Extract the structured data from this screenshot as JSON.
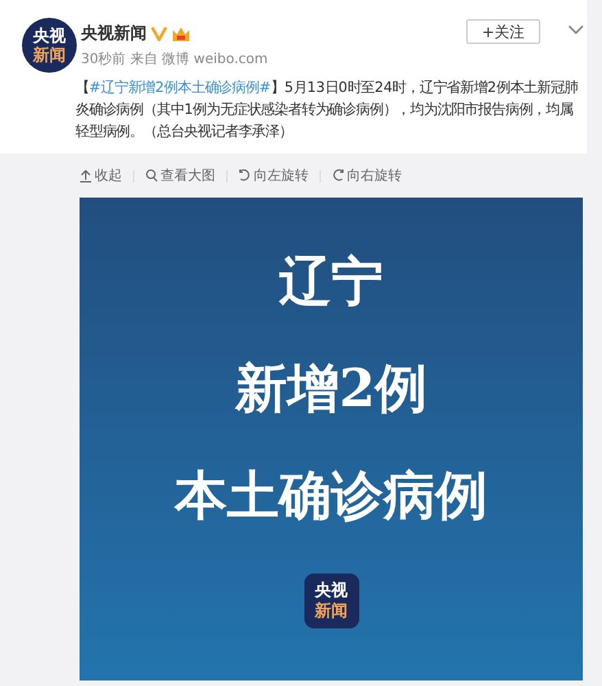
{
  "post": {
    "author": "央视新闻",
    "avatar_text": [
      "央视",
      "新闻"
    ],
    "time": "30秒前",
    "source_prefix": "来自",
    "source": "微博 weibo.com",
    "follow_button": "+关注",
    "hashtag_open": "【",
    "hashtag": "#辽宁新增2例本土确诊病例#",
    "hashtag_close": "】",
    "body": "5月13日0时至24时，辽宁省新增2例本土新冠肺炎确诊病例（其中1例为无症状感染者转为确诊病例），均为沈阳市报告病例，均属轻型病例。（总台央视记者李承泽）"
  },
  "toolbar": [
    {
      "kind": "collapse",
      "label": "收起"
    },
    {
      "kind": "zoom",
      "label": "查看大图"
    },
    {
      "kind": "rotate-left",
      "label": "向左旋转"
    },
    {
      "kind": "rotate-right",
      "label": "向右旋转"
    }
  ],
  "image": {
    "lines": [
      "辽宁",
      "新增2例",
      "本土确诊病例"
    ],
    "logo": [
      "央视",
      "新闻"
    ]
  }
}
